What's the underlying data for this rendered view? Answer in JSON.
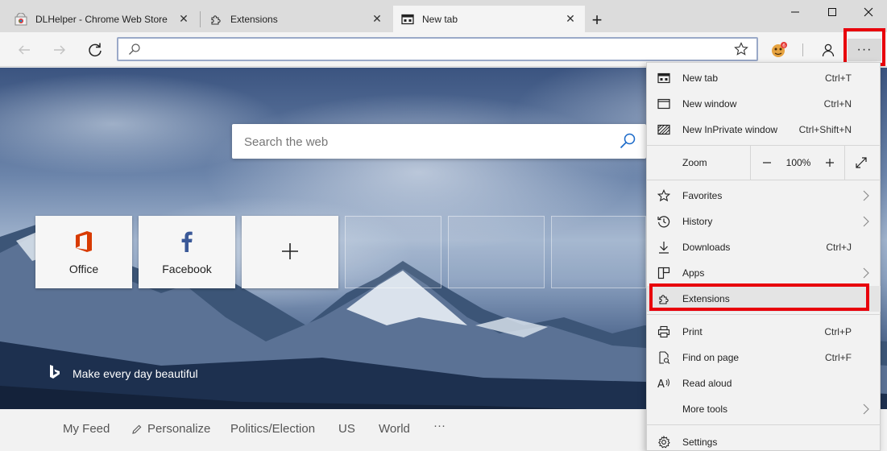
{
  "tabs": [
    {
      "title": "DLHelper - Chrome Web Store",
      "icon": "chrome-webstore-icon",
      "active": false
    },
    {
      "title": "Extensions",
      "icon": "extensions-puzzle-icon",
      "active": false
    },
    {
      "title": "New tab",
      "icon": "new-tab-page-icon",
      "active": true
    }
  ],
  "window_controls": {
    "minimize": "—",
    "maximize": "☐",
    "close": "✕"
  },
  "toolbar": {
    "address_value": "",
    "more_label": "···"
  },
  "page": {
    "search_placeholder": "Search the web",
    "tiles": [
      {
        "label": "Office",
        "icon": "office-icon"
      },
      {
        "label": "Facebook",
        "icon": "facebook-icon"
      },
      {
        "label": "",
        "icon": "plus-icon"
      }
    ],
    "tagline": "Make every day beautiful",
    "feed": [
      "My Feed",
      "Personalize",
      "Politics/Election",
      "US",
      "World",
      "···"
    ]
  },
  "menu": {
    "items": [
      {
        "label": "New tab",
        "shortcut": "Ctrl+T"
      },
      {
        "label": "New window",
        "shortcut": "Ctrl+N"
      },
      {
        "label": "New InPrivate window",
        "shortcut": "Ctrl+Shift+N"
      },
      {
        "label": "Favorites",
        "shortcut": ""
      },
      {
        "label": "History",
        "shortcut": ""
      },
      {
        "label": "Downloads",
        "shortcut": "Ctrl+J"
      },
      {
        "label": "Apps",
        "shortcut": ""
      },
      {
        "label": "Extensions",
        "shortcut": ""
      },
      {
        "label": "Print",
        "shortcut": "Ctrl+P"
      },
      {
        "label": "Find on page",
        "shortcut": "Ctrl+F"
      },
      {
        "label": "Read aloud",
        "shortcut": ""
      },
      {
        "label": "More tools",
        "shortcut": ""
      },
      {
        "label": "Settings",
        "shortcut": ""
      }
    ],
    "zoom": {
      "label": "Zoom",
      "minus": "—",
      "value": "100%",
      "plus": "+"
    }
  },
  "colors": {
    "highlight": "#e8000b",
    "office": "#d83b01",
    "facebook": "#3b5998",
    "address_border": "#9aa9c8"
  }
}
